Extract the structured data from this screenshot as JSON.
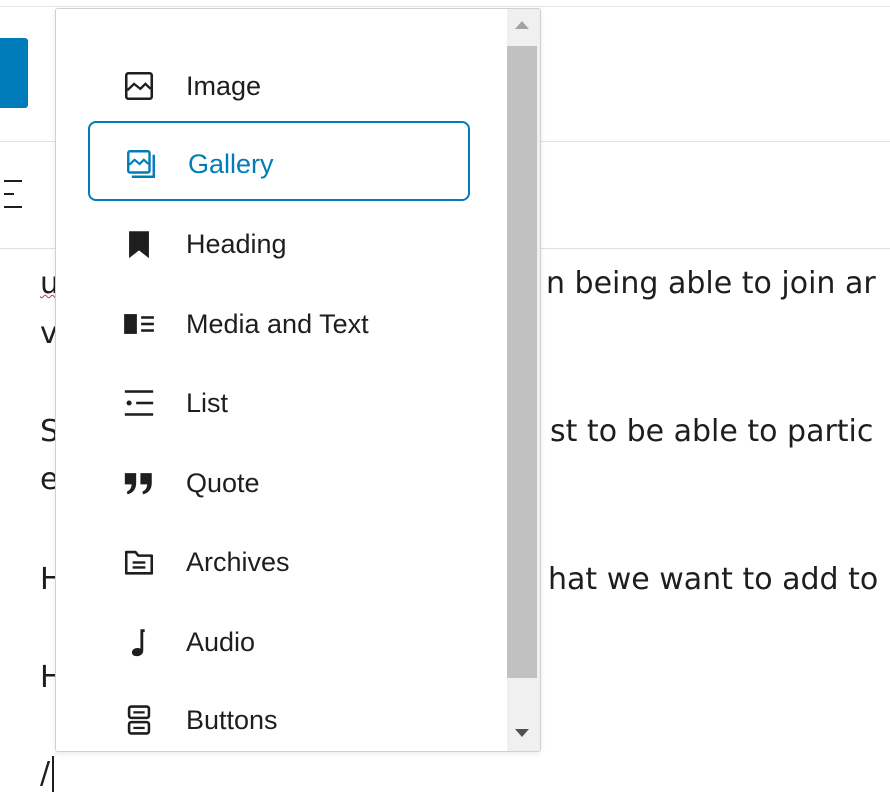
{
  "editor": {
    "line1_left": "u",
    "line1_right": "n being able to join ar",
    "line1b_left": "v",
    "line2_left": "S",
    "line2_right": "st to be able to partic",
    "line2b_left": "e",
    "line3_left": "H",
    "line3_right": "hat we want to add to",
    "line4_left": "H",
    "line5": "/"
  },
  "inserter": {
    "items": [
      {
        "label": "Image",
        "icon": "image-icon"
      },
      {
        "label": "Gallery",
        "icon": "gallery-icon"
      },
      {
        "label": "Heading",
        "icon": "bookmark-icon"
      },
      {
        "label": "Media and Text",
        "icon": "media-text-icon"
      },
      {
        "label": "List",
        "icon": "list-icon"
      },
      {
        "label": "Quote",
        "icon": "quote-icon"
      },
      {
        "label": "Archives",
        "icon": "archive-icon"
      },
      {
        "label": "Audio",
        "icon": "audio-icon"
      },
      {
        "label": "Buttons",
        "icon": "buttons-icon"
      }
    ],
    "selected": "Gallery"
  },
  "colors": {
    "accent": "#007cba",
    "text": "#1e1e1e"
  }
}
